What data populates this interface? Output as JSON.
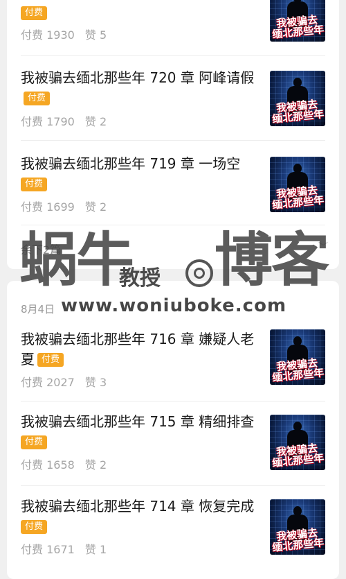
{
  "cover_art_text": "我被骗去\n缅北那些年",
  "top_section": {
    "articles": [
      {
        "title": "",
        "badge": "付费",
        "pay_count": "付费 1930",
        "likes": "赞 5"
      },
      {
        "title": "我被骗去缅北那些年 720 章 阿峰请假",
        "badge": "付费",
        "pay_count": "付费 1790",
        "likes": "赞 2"
      },
      {
        "title": "我被骗去缅北那些年 719 章 一场空",
        "badge": "付费",
        "pay_count": "付费 1699",
        "likes": "赞 2"
      }
    ],
    "remaining_label": "余下2篇"
  },
  "bottom_section": {
    "date": "8月4日",
    "articles": [
      {
        "title": "我被骗去缅北那些年 716 章 嫌疑人老夏",
        "badge": "付费",
        "pay_count": "付费 2027",
        "likes": "赞 3"
      },
      {
        "title": "我被骗去缅北那些年 715 章 精细排查",
        "badge": "付费",
        "pay_count": "付费 1658",
        "likes": "赞 2"
      },
      {
        "title": "我被骗去缅北那些年 714 章 恢复完成",
        "badge": "付费",
        "pay_count": "付费 1671",
        "likes": "赞 1"
      }
    ]
  },
  "watermark": {
    "left_chars": "蜗牛",
    "middle": "教授",
    "right_chars": "博客",
    "url": "www.woniuboke.com"
  },
  "icons": {
    "expand": "chevron-down-icon",
    "cover": "book-cover-image"
  }
}
